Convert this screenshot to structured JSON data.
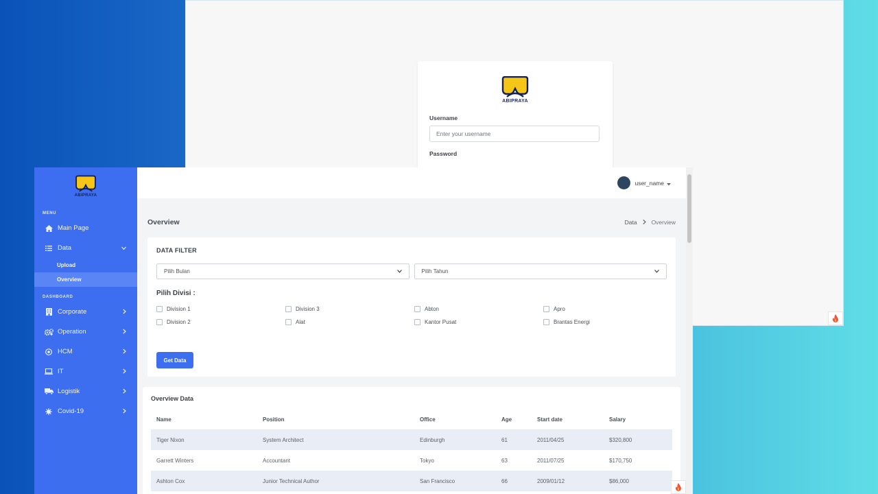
{
  "brand": {
    "name": "ABIPRAYA",
    "colors": {
      "primary": "#3d6ef0",
      "logo_yellow": "#f5c518",
      "logo_navy": "#14225a"
    }
  },
  "login": {
    "username_label": "Username",
    "username_placeholder": "Enter your username",
    "password_label": "Password"
  },
  "sidebar": {
    "menu_header": "MENU",
    "dashboard_header": "DASHBOARD",
    "items": [
      {
        "label": "Main Page",
        "icon": "home-icon"
      },
      {
        "label": "Data",
        "icon": "list-icon"
      }
    ],
    "data_sub": [
      {
        "label": "Upload"
      },
      {
        "label": "Overview"
      }
    ],
    "dashboard_items": [
      {
        "label": "Corporate",
        "icon": "building-icon"
      },
      {
        "label": "Operation",
        "icon": "cogs-icon"
      },
      {
        "label": "HCM",
        "icon": "target-icon"
      },
      {
        "label": "IT",
        "icon": "laptop-icon"
      },
      {
        "label": "Logistik",
        "icon": "truck-icon"
      },
      {
        "label": "Covid-19",
        "icon": "virus-icon"
      }
    ]
  },
  "topbar": {
    "user_name": "user_name"
  },
  "page": {
    "title": "Overview",
    "breadcrumb": {
      "parent": "Data",
      "current": "Overview"
    }
  },
  "filter": {
    "title": "DATA FILTER",
    "month_select": "Pilih Bulan",
    "year_select": "Pilih Tahun",
    "division_label": "Pilih Divisi :",
    "divisions": [
      "Division 1",
      "Division 3",
      "Abton",
      "Apro",
      "Division 2",
      "Alat",
      "Kantor Pusat",
      "Brantas Energi"
    ],
    "button": "Get Data"
  },
  "table": {
    "title": "Overview Data",
    "headers": [
      "Name",
      "Position",
      "Office",
      "Age",
      "Start date",
      "Salary"
    ],
    "rows": [
      [
        "Tiger Nixon",
        "System Architect",
        "Edinburgh",
        "61",
        "2011/04/25",
        "$320,800"
      ],
      [
        "Garrett Winters",
        "Accountant",
        "Tokyo",
        "63",
        "2011/07/25",
        "$170,750"
      ],
      [
        "Ashton Cox",
        "Junior Technical Author",
        "San Francisco",
        "66",
        "2009/01/12",
        "$86,000"
      ]
    ]
  }
}
